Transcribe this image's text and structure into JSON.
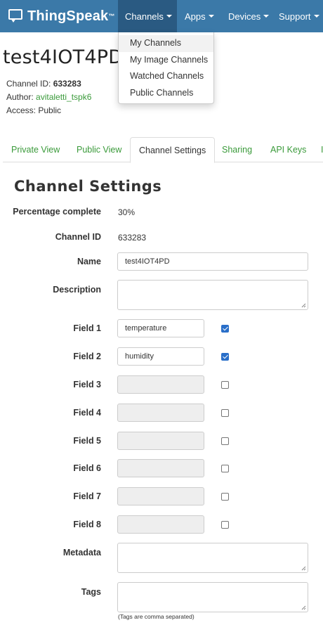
{
  "navbar": {
    "brand": "ThingSpeak",
    "brand_tm": "™",
    "items": [
      {
        "label": "Channels"
      },
      {
        "label": "Apps"
      },
      {
        "label": "Devices"
      },
      {
        "label": "Support"
      }
    ],
    "colors": {
      "bar": "#3b79a8",
      "active": "#2a5a82"
    }
  },
  "channels_menu": {
    "items": [
      "My Channels",
      "My Image Channels",
      "Watched Channels",
      "Public Channels"
    ]
  },
  "channel": {
    "title": "test4IOT4PD",
    "id_label": "Channel ID: ",
    "id": "633283",
    "author_label": "Author: ",
    "author": "avitaletti_tspk6",
    "access_label": "Access: ",
    "access": "Public"
  },
  "tabs": [
    "Private View",
    "Public View",
    "Channel Settings",
    "Sharing",
    "API Keys",
    "I"
  ],
  "settings": {
    "title": "Channel Settings",
    "percentage_label": "Percentage complete",
    "percentage": "30%",
    "channel_id_label": "Channel ID",
    "channel_id": "633283",
    "name_label": "Name",
    "name": "test4IOT4PD",
    "description_label": "Description",
    "fields": [
      {
        "label": "Field 1",
        "value": "temperature",
        "checked": true
      },
      {
        "label": "Field 2",
        "value": "humidity",
        "checked": true
      },
      {
        "label": "Field 3",
        "value": "",
        "checked": false
      },
      {
        "label": "Field 4",
        "value": "",
        "checked": false
      },
      {
        "label": "Field 5",
        "value": "",
        "checked": false
      },
      {
        "label": "Field 6",
        "value": "",
        "checked": false
      },
      {
        "label": "Field 7",
        "value": "",
        "checked": false
      },
      {
        "label": "Field 8",
        "value": "",
        "checked": false
      }
    ],
    "metadata_label": "Metadata",
    "tags_label": "Tags",
    "tags_hint": "(Tags are comma separated)"
  }
}
